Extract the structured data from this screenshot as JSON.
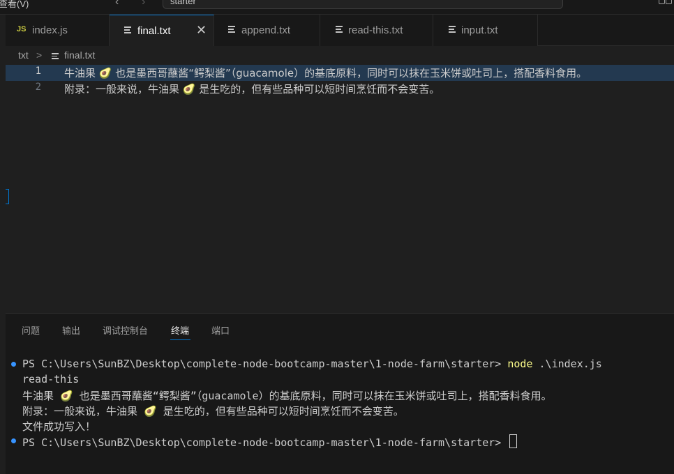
{
  "titlebar": {
    "view_menu": "查看(V)",
    "command_center": "starter",
    "back_icon": "chevron-left-icon",
    "forward_icon": "chevron-right-icon",
    "layout_icon": "layout-icon"
  },
  "tabs": [
    {
      "label": "index.js",
      "icon": "js-file-icon",
      "active": false
    },
    {
      "label": "final.txt",
      "icon": "text-file-icon",
      "active": true,
      "close": "✕"
    },
    {
      "label": "append.txt",
      "icon": "text-file-icon",
      "active": false
    },
    {
      "label": "read-this.txt",
      "icon": "text-file-icon",
      "active": false
    },
    {
      "label": "input.txt",
      "icon": "text-file-icon",
      "active": false
    }
  ],
  "breadcrumb": {
    "folder": "txt",
    "separator": ">",
    "file": "final.txt"
  },
  "editor": {
    "lines": [
      {
        "number": "1",
        "text": "牛油果 🥑 也是墨西哥蘸酱“鳄梨酱”（guacamole）的基底原料，同时可以抹在玉米饼或吐司上，搭配香料食用。"
      },
      {
        "number": "2",
        "text": "附录：一般来说，牛油果 🥑 是生吃的，但有些品种可以短时间烹饪而不会变苦。"
      }
    ]
  },
  "panel": {
    "tabs": [
      "问题",
      "输出",
      "调试控制台",
      "终端",
      "端口"
    ],
    "active_tab": "终端"
  },
  "terminal": {
    "prompt": "PS C:\\Users\\SunBZ\\Desktop\\complete-node-bootcamp-master\\1-node-farm\\starter> ",
    "command_name": "node",
    "command_args": " .\\index.js",
    "output": [
      "read-this",
      "牛油果 🥑 也是墨西哥蘸酱“鳄梨酱”（guacamole）的基底原料，同时可以抹在玉米饼或吐司上，搭配香料食用。",
      "附录：一般来说，牛油果 🥑 是生吃的，但有些品种可以短时间烹饪而不会变苦。",
      "文件成功写入！"
    ],
    "prompt2": "PS C:\\Users\\SunBZ\\Desktop\\complete-node-bootcamp-master\\1-node-farm\\starter> "
  },
  "colors": {
    "accent": "#0078d4",
    "command": "#ffff8c",
    "dot": "#3794ff",
    "selection": "#264f78"
  }
}
